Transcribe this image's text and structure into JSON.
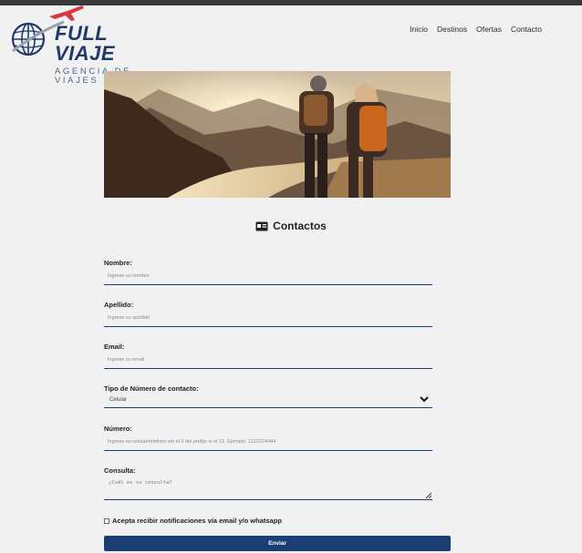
{
  "brand": {
    "name": "FULL VIAJE",
    "tagline": "AGENCIA DE VIAJES"
  },
  "nav": {
    "items": [
      "Inicio",
      "Destinos",
      "Ofertas",
      "Contacto"
    ]
  },
  "section": {
    "title": "Contactos"
  },
  "form": {
    "nombre": {
      "label": "Nombre:",
      "placeholder": "Ingrese su nombre"
    },
    "apellido": {
      "label": "Apellido:",
      "placeholder": "Ingrese su apellido"
    },
    "email": {
      "label": "Email:",
      "placeholder": "Ingrese su email"
    },
    "tipo": {
      "label": "Tipo de Número de contacto:",
      "selected": "Celular"
    },
    "numero": {
      "label": "Número:",
      "placeholder": "Ingrese su celular/telefono sin el 0 del prefijo ni el 15. Ejemplo: 1122224444"
    },
    "consulta": {
      "label": "Consulta:",
      "placeholder": "¿Cuál es su consulta?"
    },
    "consent_label": "Acepta recibir notificaciones vía email y/o whatsapp",
    "submit_label": "Enviar"
  },
  "colors": {
    "accent": "#1b3f73",
    "brand_text": "#1f3a68",
    "plane": "#d9363e"
  },
  "icons": {
    "logo": "globe-plane-logo-icon",
    "section": "contact-card-icon",
    "select": "chevron-down-icon"
  }
}
